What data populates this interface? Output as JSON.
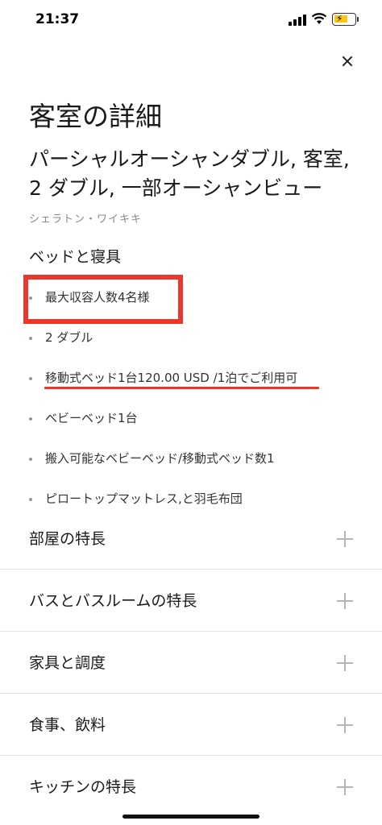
{
  "status_bar": {
    "time": "21:37"
  },
  "page": {
    "title": "客室の詳細",
    "room_name": "パーシャルオーシャンダブル, 客室, 2 ダブル, 一部オーシャンビュー",
    "hotel_name": "シェラトン・ワイキキ"
  },
  "beds_section": {
    "heading": "ベッドと寝具",
    "items": [
      "最大収容人数4名様",
      "2 ダブル",
      "移動式ベッド1台120.00 USD /1泊でご利用可",
      "ベビーベッド1台",
      "搬入可能なベビーベッド/移動式ベッド数1",
      "ピロートップマットレス,と羽毛布団"
    ]
  },
  "accordion": [
    {
      "label": "部屋の特長"
    },
    {
      "label": "バスとバスルームの特長"
    },
    {
      "label": "家具と調度"
    },
    {
      "label": "食事、飲料"
    },
    {
      "label": "キッチンの特長"
    }
  ],
  "colors": {
    "annotation_red": "#e8382d",
    "battery_yellow": "#f6c611",
    "muted_text": "#8a8a8a"
  },
  "icons": [
    "close-icon",
    "plus-icon",
    "signal-icon",
    "wifi-icon",
    "battery-icon"
  ]
}
